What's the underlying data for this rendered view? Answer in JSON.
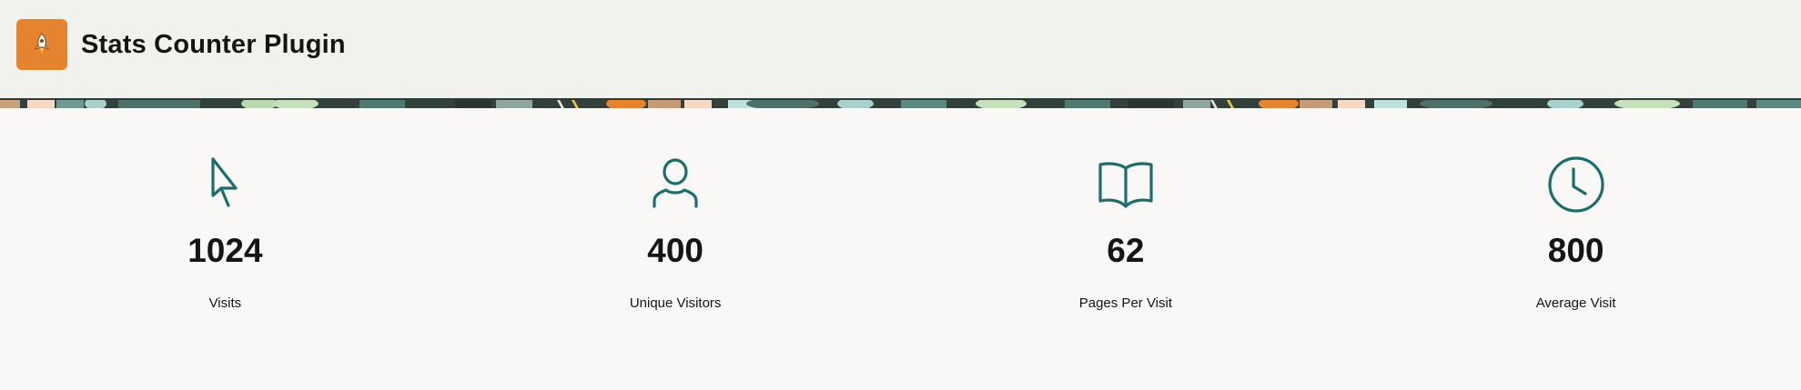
{
  "app": {
    "title": "Stats Counter Plugin",
    "icon": "rocket-icon",
    "icon_color": "#e5832f"
  },
  "accent_color": "#1c6e6e",
  "stats": [
    {
      "value": "1024",
      "label": "Visits",
      "icon": "cursor-pointer-icon"
    },
    {
      "value": "400",
      "label": "Unique Visitors",
      "icon": "user-icon"
    },
    {
      "value": "62",
      "label": "Pages Per Visit",
      "icon": "open-book-icon"
    },
    {
      "value": "800",
      "label": "Average Visit",
      "icon": "clock-icon"
    }
  ]
}
